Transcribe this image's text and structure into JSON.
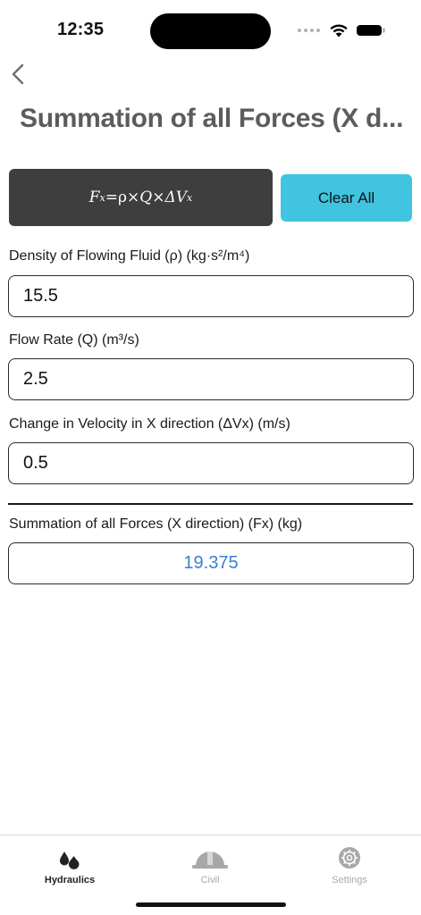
{
  "status": {
    "time": "12:35"
  },
  "header": {
    "title": "Summation of all Forces (X d..."
  },
  "formula": {
    "lhs": "F",
    "lhs_sub": "x",
    "equals": " = ",
    "rho": "ρ",
    "times1": " × ",
    "q": "Q",
    "times2": " × ",
    "delta_v": "ΔV",
    "delta_v_sub": "x"
  },
  "actions": {
    "clear_all_label": "Clear All"
  },
  "fields": [
    {
      "label": "Density of Flowing Fluid (ρ) (kg·s²/m⁴)",
      "value": "15.5"
    },
    {
      "label": "Flow Rate (Q) (m³/s)",
      "value": "2.5"
    },
    {
      "label": "Change in Velocity in X direction (ΔVx) (m/s)",
      "value": "0.5"
    }
  ],
  "result": {
    "label": "Summation of all Forces (X direction) (Fx) (kg)",
    "value": "19.375",
    "color": "#3a7fd6"
  },
  "tabbar": {
    "tabs": [
      {
        "label": "Hydraulics",
        "icon": "water-drops-icon",
        "active": true
      },
      {
        "label": "Civil",
        "icon": "hard-hat-icon",
        "active": false
      },
      {
        "label": "Settings",
        "icon": "gear-icon",
        "active": false
      }
    ]
  },
  "colors": {
    "accent": "#40c4df",
    "formula_bg": "#3e3e3e",
    "result_text": "#3a7fd6"
  }
}
